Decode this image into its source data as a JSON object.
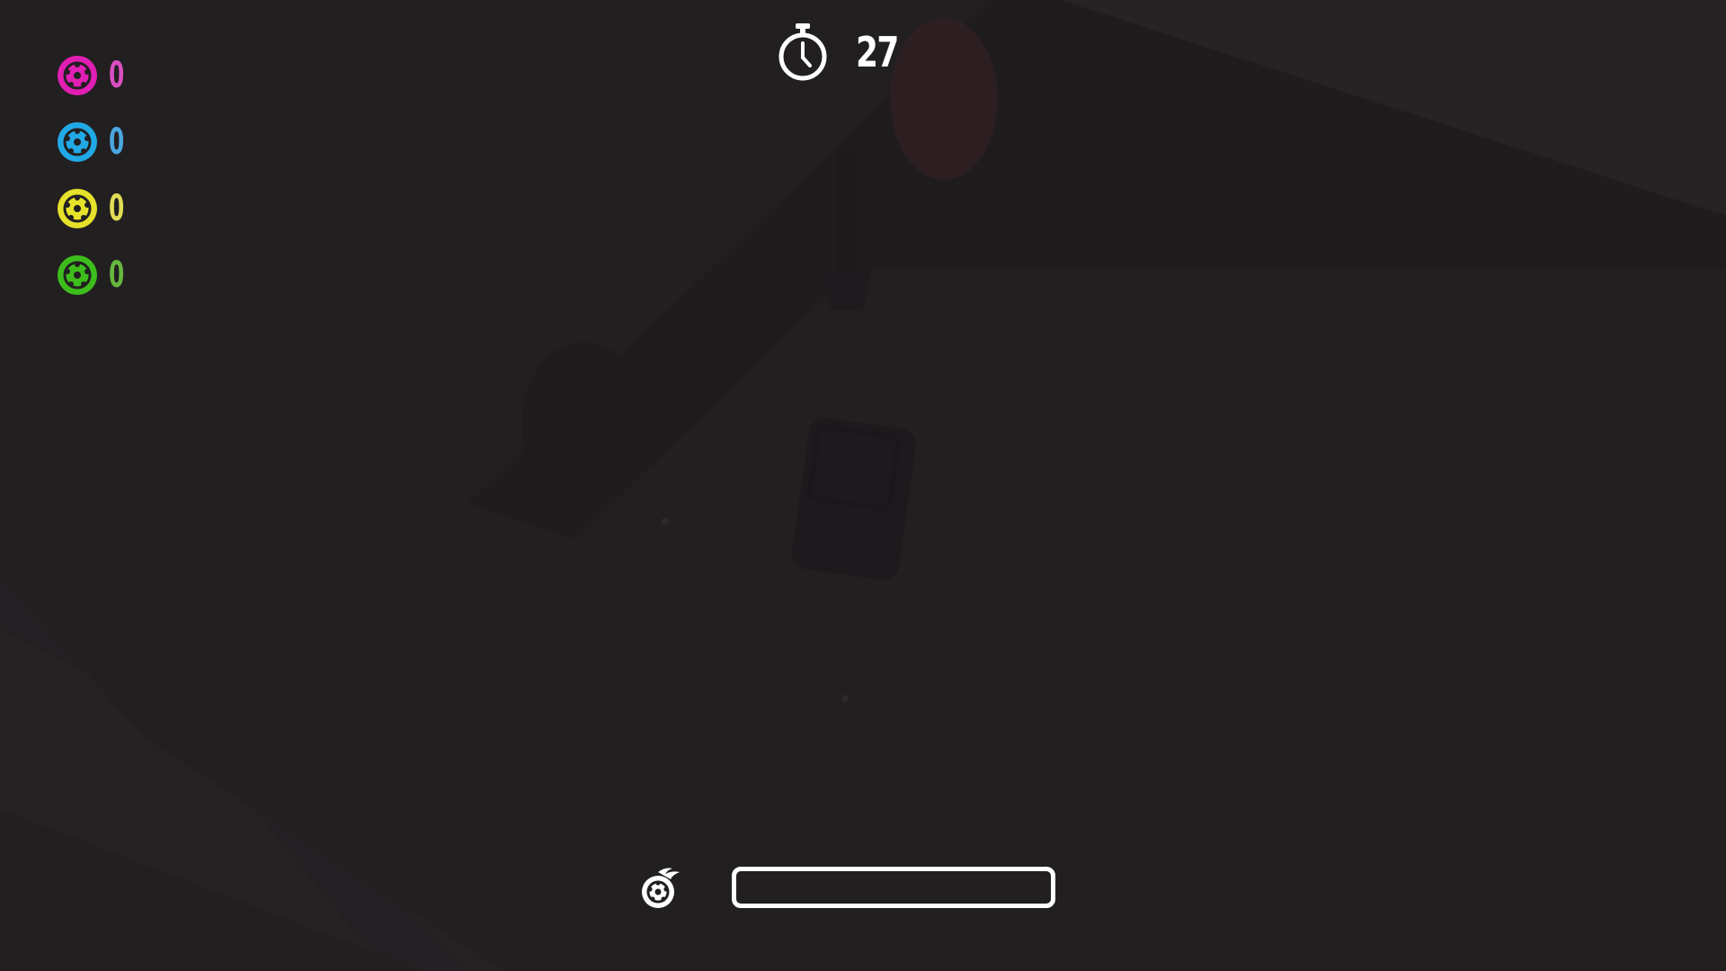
{
  "hud": {
    "scores": [
      {
        "icon": "magenta-wheel-icon",
        "color": "#e21fb4",
        "text_color": "#d94fc0",
        "value": "0"
      },
      {
        "icon": "blue-wheel-icon",
        "color": "#21a9e6",
        "text_color": "#4aa6df",
        "value": "0"
      },
      {
        "icon": "yellow-wheel-icon",
        "color": "#e6e12a",
        "text_color": "#e0dc55",
        "value": "0"
      },
      {
        "icon": "green-wheel-icon",
        "color": "#3dbd1c",
        "text_color": "#66b83f",
        "value": "0"
      }
    ],
    "timer": {
      "icon": "stopwatch-icon",
      "value": "27"
    },
    "boost": {
      "icon": "flaming-wheel-icon",
      "level": 0
    }
  },
  "colors": {
    "background": "#221f21",
    "hud_white": "#ffffff"
  }
}
